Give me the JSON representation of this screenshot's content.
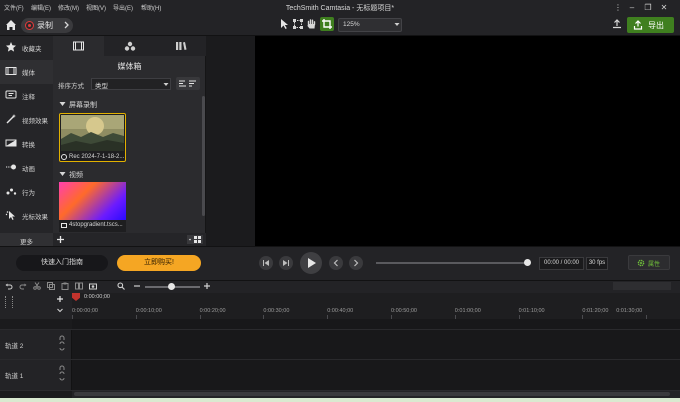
{
  "menu": [
    "文件(F)",
    "编辑(E)",
    "修改(M)",
    "视图(V)",
    "导出(E)",
    "帮助(H)"
  ],
  "app_title": "TechSmith Camtasia - 无标题项目*",
  "toolbar": {
    "record_label": "录制",
    "zoom_value": "125%",
    "export_label": "导出"
  },
  "rail": {
    "items": [
      {
        "label": "收藏夹",
        "icon": "star-icon"
      },
      {
        "label": "媒体",
        "icon": "film-icon"
      },
      {
        "label": "注释",
        "icon": "annotation-icon"
      },
      {
        "label": "视频效果",
        "icon": "wand-icon"
      },
      {
        "label": "转换",
        "icon": "transition-icon"
      },
      {
        "label": "动画",
        "icon": "animation-icon"
      },
      {
        "label": "行为",
        "icon": "behavior-icon"
      },
      {
        "label": "光标效果",
        "icon": "cursor-icon"
      }
    ],
    "more_label": "更多"
  },
  "panel": {
    "title": "媒体箱",
    "sort_label": "排序方式",
    "sort_value": "类型",
    "groups": [
      {
        "name": "屏幕录制",
        "items": [
          {
            "name": "Rec 2024-7-1-18-2..."
          }
        ]
      },
      {
        "name": "视频",
        "items": [
          {
            "name": "4stopgradient.tscs..."
          }
        ]
      }
    ]
  },
  "transport": {
    "quickstart_label": "快速入门指南",
    "buy_label": "立即购买!",
    "time": "00:00 / 00:00",
    "fps": "30 fps",
    "props_label": "属性"
  },
  "timeline": {
    "playhead_time": "0:00:00;00",
    "ruler": [
      "0:00:00;00",
      "0:00:10;00",
      "0:00:20;00",
      "0:00:30;00",
      "0:00:40;00",
      "0:00:50;00",
      "0:01:00;00",
      "0:01:10;00",
      "0:01:20;00",
      "0:01:30;00"
    ],
    "tracks": [
      "轨道 2",
      "轨道 1"
    ]
  },
  "colors": {
    "accent_green": "#3f7f1f",
    "buy_orange": "#f5a623",
    "selection_yellow": "#e2b100",
    "record_red": "#e23a3a"
  }
}
